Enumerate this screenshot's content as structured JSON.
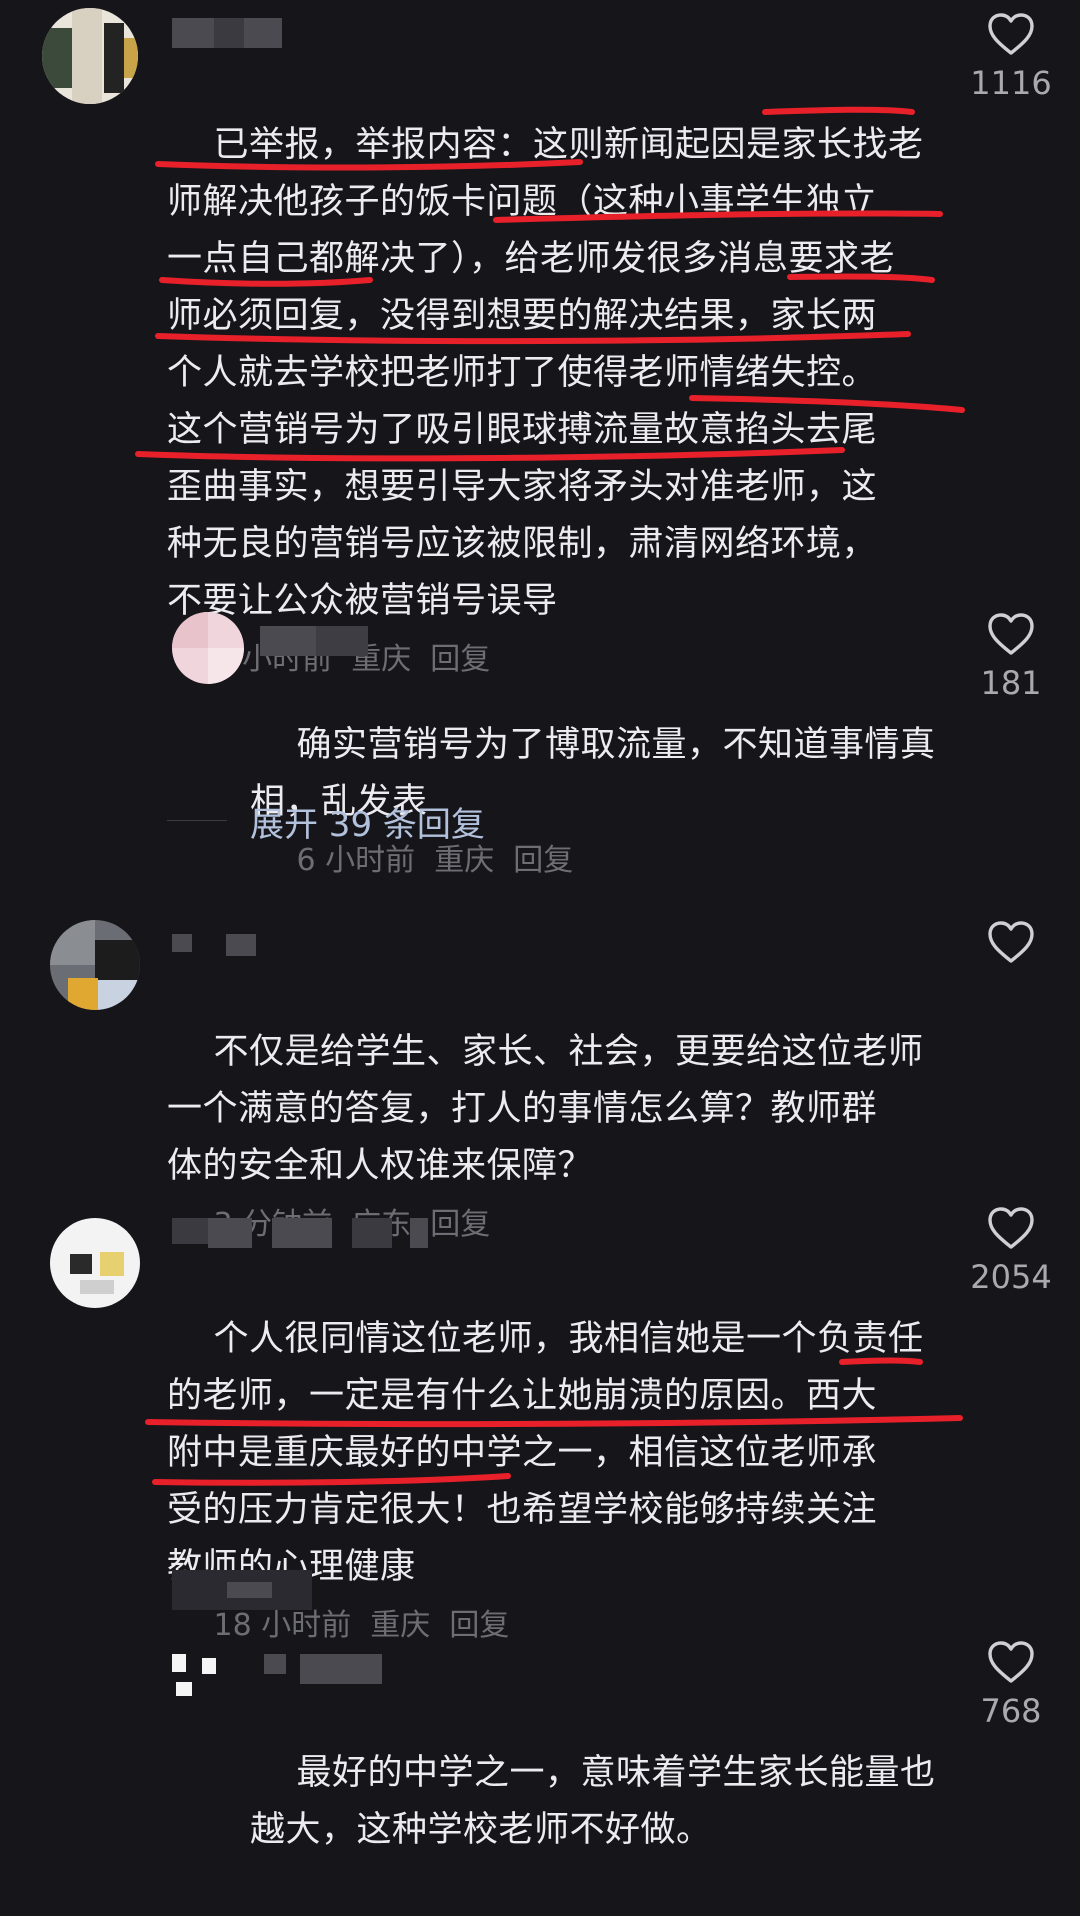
{
  "comments": [
    {
      "text": "已举报，举报内容：这则新闻起因是家长找老\n师解决他孩子的饭卡问题（这种小事学生独立\n一点自己都解决了），给老师发很多消息要求老\n师必须回复，没得到想要的解决结果，家长两\n个人就去学校把老师打了使得老师情绪失控。\n这个营销号为了吸引眼球搏流量故意掐头去尾\n歪曲事实，想要引导大家将矛头对准老师，这\n种无良的营销号应该被限制，肃清网络环境，\n不要让公众被营销号误导",
      "meta": "6 小时前  重庆  回复",
      "likes": "1116"
    },
    {
      "text": "确实营销号为了博取流量，不知道事情真\n相，乱发表",
      "meta": "6 小时前  重庆  回复",
      "likes": "181"
    },
    {
      "text": "不仅是给学生、家长、社会，更要给这位老师\n一个满意的答复，打人的事情怎么算？教师群\n体的安全和人权谁来保障？",
      "meta": "3 分钟前  广东  回复",
      "likes": ""
    },
    {
      "text": "个人很同情这位老师，我相信她是一个负责任\n的老师，一定是有什么让她崩溃的原因。西大\n附中是重庆最好的中学之一，相信这位老师承\n受的压力肯定很大！也希望学校能够持续关注\n教师的心理健康",
      "meta": "18 小时前  重庆  回复",
      "likes": "2054"
    },
    {
      "text": "最好的中学之一，意味着学生家长能量也\n越大，这种学校老师不好做。",
      "meta": "",
      "likes": "768"
    }
  ],
  "expand_replies": "展开 39 条回复",
  "colors": {
    "background": "#16151a",
    "text": "#ececef",
    "meta": "#6d6d74",
    "link": "#b3c2dc",
    "annotation_red": "#e8202a"
  },
  "icons": [
    "heart-icon"
  ]
}
